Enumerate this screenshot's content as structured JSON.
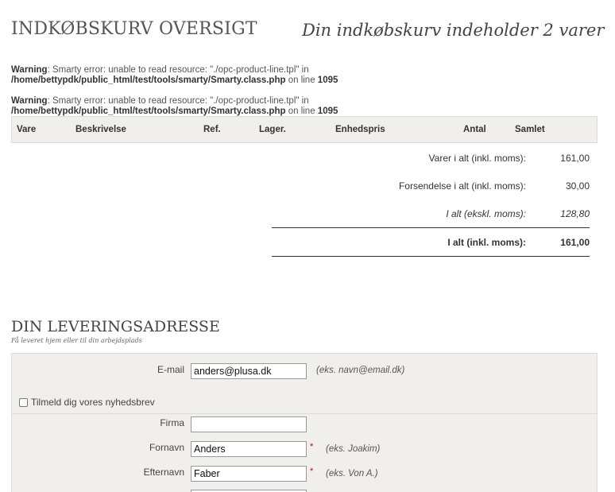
{
  "header": {
    "title": "INDKØBSKURV OVERSIGT",
    "cart_count": "Din indkøbskurv indeholder 2 varer"
  },
  "warnings": [
    {
      "label": "Warning",
      "message": ": Smarty error: unable to read resource: \"./opc-product-line.tpl\" in",
      "path": "/home/bettypdk/public_html/test/tools/smarty/Smarty.class.php",
      "on_line": " on line ",
      "line": "1095"
    },
    {
      "label": "Warning",
      "message": ": Smarty error: unable to read resource: \"./opc-product-line.tpl\" in",
      "path": "/home/bettypdk/public_html/test/tools/smarty/Smarty.class.php",
      "on_line": " on line ",
      "line": "1095"
    }
  ],
  "cart_table": {
    "columns": [
      "Vare",
      "Beskrivelse",
      "Ref.",
      "Lager.",
      "Enhedspris",
      "Antal",
      "Samlet"
    ]
  },
  "summary": [
    {
      "label": "Varer i alt (inkl. moms):",
      "value": "161,00",
      "style": "normal"
    },
    {
      "label": "Forsendelse i alt (inkl. moms):",
      "value": "30,00",
      "style": "normal"
    },
    {
      "label": "I alt (ekskl. moms):",
      "value": "128,80",
      "style": "italic"
    },
    {
      "label": "I alt (inkl. moms):",
      "value": "161,00",
      "style": "bold"
    }
  ],
  "delivery": {
    "title": "DIN LEVERINGSADRESSE",
    "subtitle": "Få leveret hjem eller til din arbejdsplads",
    "email": {
      "label": "E-mail",
      "value": "anders@plusa.dk",
      "hint": "(eks. navn@email.dk)"
    },
    "newsletter_label": "Tilmeld dig vores nyhedsbrev",
    "company": {
      "label": "Firma",
      "value": ""
    },
    "first_name": {
      "label": "Fornavn",
      "value": "Anders",
      "required": "*",
      "hint": "(eks. Joakim)"
    },
    "last_name": {
      "label": "Efternavn",
      "value": "Faber",
      "required": "*",
      "hint": "(eks. Von A.)"
    }
  }
}
